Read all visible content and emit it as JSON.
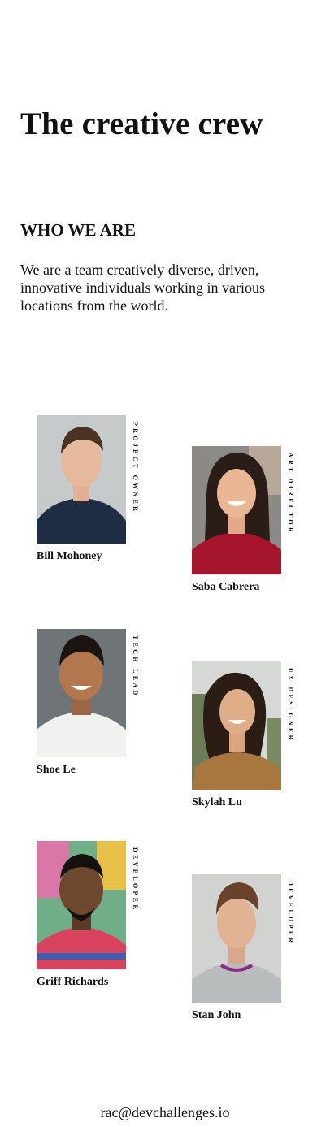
{
  "header": {
    "title": "The creative crew"
  },
  "about": {
    "heading": "WHO WE ARE",
    "text": "We are a team creatively diverse, driven, innovative individuals working in various locations from the world."
  },
  "team": [
    {
      "name": "Bill Mohoney",
      "role": "PROJECT OWNER"
    },
    {
      "name": "Saba Cabrera",
      "role": "ART DIRECTOR"
    },
    {
      "name": "Shoe Le",
      "role": "TECH LEAD"
    },
    {
      "name": "Skylah Lu",
      "role": "UX DESIGNER"
    },
    {
      "name": "Griff Richards",
      "role": "DEVELOPER"
    },
    {
      "name": "Stan John",
      "role": "DEVELOPER"
    }
  ],
  "footer": {
    "email": "rac@devchallenges.io"
  },
  "colors": {
    "text": "#111111",
    "background": "#ffffff"
  }
}
